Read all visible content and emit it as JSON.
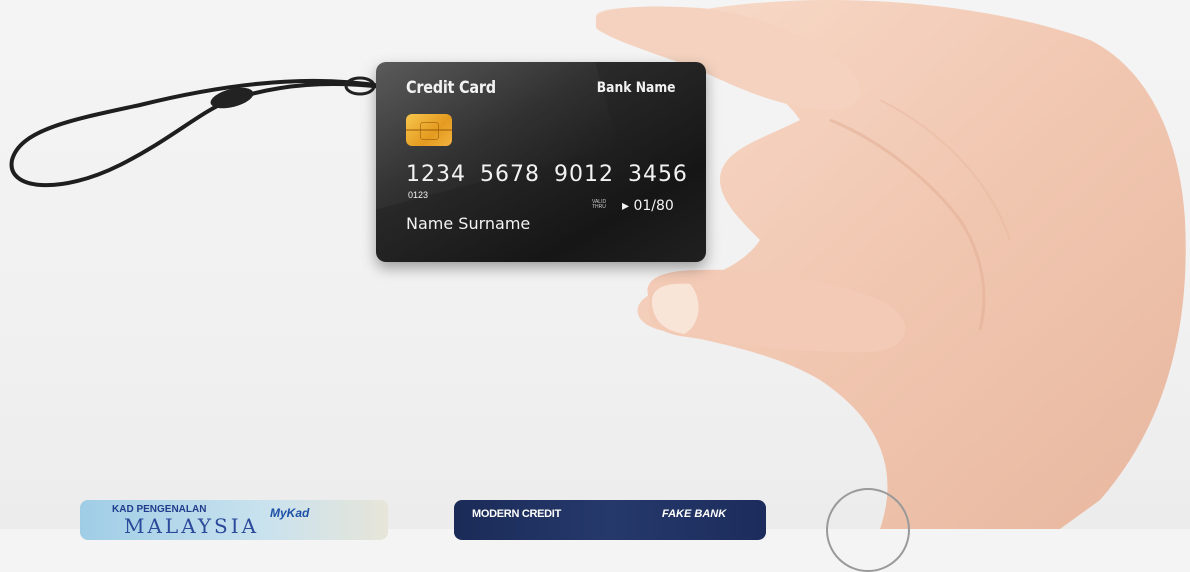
{
  "card": {
    "title": "Credit Card",
    "bank": "Bank Name",
    "number": "1234 5678 9012 3456",
    "small": "0123",
    "valid_label_1": "VALID",
    "valid_label_2": "THRU",
    "expiry": "01/80",
    "holder": "Name Surname"
  },
  "thumbnails": [
    {
      "line1": "KAD PENGENALAN",
      "line2": "MyKad",
      "line3": "MALAYSIA"
    },
    {
      "line1": "MODERN CREDIT",
      "line2": "FAKE BANK"
    }
  ],
  "colors": {
    "card_dark": "#161616",
    "chip_gold": "#e49a1f",
    "skin": "#f3cdb8"
  }
}
